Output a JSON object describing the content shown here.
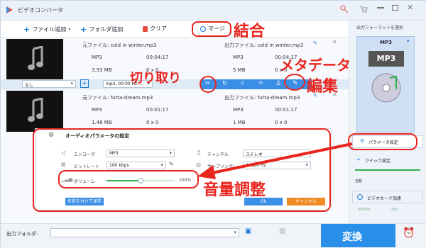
{
  "app": {
    "title": "ビデオコンバータ"
  },
  "toolbar": {
    "add_file": "ファイル追加",
    "add_folder": "フォルダ追加",
    "clear": "クリア",
    "merge": "マージ"
  },
  "files": [
    {
      "src_label": "元ファイル: cold in winter.mp3",
      "out_label": "出力ファイル: cold in winter.mp3",
      "format": "MP3",
      "duration": "00:04:17",
      "size": "3.93 MB",
      "dimensions": "0 x 0",
      "out_format": "MP3",
      "out_duration": "00:04:17",
      "out_size": "5 MB",
      "out_dimensions": "0 x 0"
    },
    {
      "src_label": "元ファイル: futta-dream.mp3",
      "out_label": "出力ファイル: futta-dream.mp3",
      "format": "MP3",
      "duration": "00:01:17",
      "size": "1.48 MB",
      "dimensions": "0 x 0",
      "out_format": "MP3",
      "out_duration": "00:01:17",
      "out_size": "1 MB",
      "out_dimensions": "0 x 0"
    }
  ],
  "edit_row": {
    "subtitle": "なし",
    "audio": "mp3, 00:00 Hz, ..."
  },
  "annotations": {
    "merge": "結合",
    "metadata": "メタデータ",
    "edit": "編集",
    "cut": "切り取り",
    "volume": "音量調整"
  },
  "dialog": {
    "title": "オーディオパラメータの設定",
    "encoder_label": "エンコーダ",
    "encoder_value": "MP3",
    "bitrate_label": "ビットレート",
    "bitrate_value": "160 kbps",
    "channel_label": "チャンネル",
    "channel_value": "ステレオ",
    "samplerate_label": "サンプリングレート",
    "samplerate_value": "44100 Hz",
    "volume_label": "ボリューム",
    "volume_value": "100%",
    "volume_level": 0.5,
    "save_as": "名前を付けて保存",
    "ok": "Ok",
    "cancel": "キャンセル"
  },
  "right_panel": {
    "output_format_label": "出力フォーマットを選択",
    "format": "MP3",
    "param_settings": "パラメータ設定",
    "quick_settings": "クイック設定",
    "auto": "自動",
    "gpu": "ビデオカード加速",
    "nvidia": "NVIDIA",
    "intel": "Intel"
  },
  "bottom": {
    "output_folder_label": "出力フォルダ:",
    "convert": "変換"
  },
  "colors": {
    "accent": "#1e7bd7",
    "red": "#e8251f",
    "convert_bg": "#2a8fe8",
    "orange": "#f08a24"
  }
}
